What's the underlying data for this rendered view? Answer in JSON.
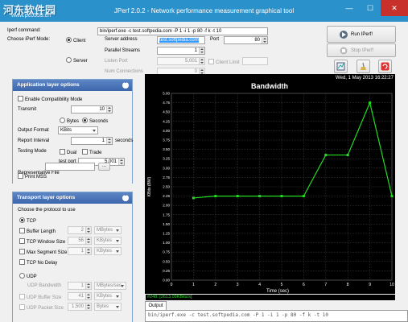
{
  "window": {
    "title": "JPerf 2.0.2 - Network performance measurement graphical tool",
    "watermark": "河东软件园",
    "watermark_url": "www.pc0359.cn",
    "minimize": "—",
    "maximize": "☐",
    "close": "✕"
  },
  "top": {
    "iperf_command_label": "Iperf command:",
    "iperf_command_value": "bin/iperf.exe -c test.softpedia.com -P 1 -i 1 -p 80 -f k -t 10",
    "mode_label": "Choose iPerf Mode:",
    "client_label": "Client",
    "server_label": "Server",
    "server_address_label": "Server address",
    "server_address_value": "test.softpedia.com",
    "port_label": "Port",
    "port_value": "80",
    "parallel_streams_label": "Parallel Streams",
    "parallel_streams_value": "1",
    "listen_port_label": "Listen Port",
    "listen_port_value": "5,001",
    "client_limit_label": "Client Limit",
    "num_connections_label": "Num Connections",
    "num_connections_value": "0",
    "run_button": "Run IPerf!",
    "stop_button": "Stop IPerf!"
  },
  "app_panel": {
    "title": "Application layer options",
    "compat_label": "Enable Compatibility Mode",
    "transmit_label": "Transmit",
    "transmit_value": "10",
    "bytes_label": "Bytes",
    "seconds_label": "Seconds",
    "output_format_label": "Output Format",
    "output_format_value": "KBits",
    "report_interval_label": "Report Interval",
    "report_interval_value": "1",
    "report_interval_unit": "seconds",
    "testing_mode_label": "Testing Mode",
    "dual_label": "Dual",
    "trade_label": "Trade",
    "test_port_label": "test port",
    "test_port_value": "5,001",
    "rep_file_label": "Representative File",
    "browse_label": "...",
    "print_mss_label": "Print MSS"
  },
  "transport_panel": {
    "title": "Transport layer options",
    "choose_protocol": "Choose the protocol to use",
    "tcp_label": "TCP",
    "buffer_length_label": "Buffer Length",
    "buffer_length_value": "2",
    "buffer_length_unit": "MBytes",
    "tcp_window_label": "TCP Window Size",
    "tcp_window_value": "56",
    "tcp_window_unit": "KBytes",
    "max_segment_label": "Max Segment Size",
    "max_segment_value": "1",
    "max_segment_unit": "KBytes",
    "no_delay_label": "TCP No Delay",
    "udp_label": "UDP",
    "udp_bandwidth_label": "UDP Bandwidth",
    "udp_bandwidth_value": "1",
    "udp_bandwidth_unit": "MBytes/sec",
    "udp_buffer_label": "UDP Buffer Size",
    "udp_buffer_value": "41",
    "udp_buffer_unit": "KBytes",
    "udp_packet_label": "UDP Packet Size",
    "udp_packet_value": "1,500",
    "udp_packet_unit": "Bytes"
  },
  "output": {
    "tab_label": "Output",
    "line": "bin/iperf.exe -c test.softpedia.com -P 1 -i 1 -p 80 -f k -t 10"
  },
  "chart_data": {
    "type": "line",
    "title": "Bandwidth",
    "date": "Wed, 1 May 2013 16:22:27",
    "xlabel": "Time (sec)",
    "ylabel": "KBits (BW)",
    "xlim": [
      0,
      10
    ],
    "ylim": [
      0,
      5
    ],
    "x_ticks": [
      0,
      1,
      2,
      3,
      4,
      5,
      6,
      7,
      8,
      9,
      10
    ],
    "y_ticks": [
      0.0,
      0.25,
      0.5,
      0.75,
      1.0,
      1.25,
      1.5,
      1.75,
      2.0,
      2.25,
      2.5,
      2.75,
      3.0,
      3.25,
      3.5,
      3.75,
      4.0,
      4.25,
      4.5,
      4.75,
      5.0
    ],
    "y_tick_labels": [
      "0.00",
      "0.25",
      "0.50",
      "0.75",
      "1.00",
      "1.25",
      "1.50",
      "1.75",
      "2.00",
      "2.25",
      "2.50",
      "2.75",
      "3.00",
      "3.25",
      "3.50",
      "3.75",
      "4.00",
      "4.25",
      "4.50",
      "4.75",
      "5.00"
    ],
    "grid": true,
    "series": [
      {
        "x": [
          1,
          2,
          3,
          4,
          5,
          6,
          7,
          8,
          9,
          10
        ],
        "values": [
          2.2,
          2.25,
          2.25,
          2.25,
          2.25,
          2.25,
          3.35,
          3.35,
          4.75,
          2.25
        ],
        "color": "#22dd22"
      }
    ],
    "legend_value": "#248: [2613.09KBits/s]",
    "legend_color": "#22dd22"
  }
}
